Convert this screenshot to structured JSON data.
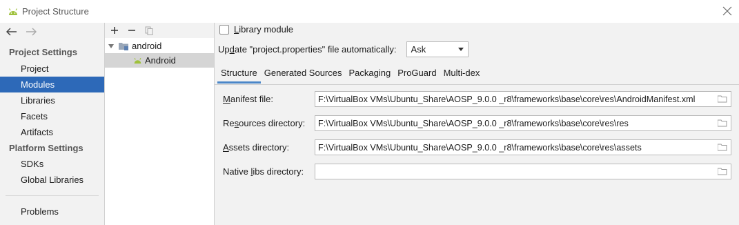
{
  "window": {
    "title": "Project Structure",
    "icon": "android-icon",
    "close_icon": "close-icon"
  },
  "sidebar": {
    "back_icon": "arrow-left-icon",
    "forward_icon": "arrow-right-icon",
    "project_settings_header": "Project Settings",
    "project_settings_items": [
      {
        "label": "Project",
        "selected": false
      },
      {
        "label": "Modules",
        "selected": true
      },
      {
        "label": "Libraries",
        "selected": false
      },
      {
        "label": "Facets",
        "selected": false
      },
      {
        "label": "Artifacts",
        "selected": false
      }
    ],
    "platform_settings_header": "Platform Settings",
    "platform_settings_items": [
      {
        "label": "SDKs"
      },
      {
        "label": "Global Libraries"
      }
    ],
    "problems_label": "Problems"
  },
  "module_tree": {
    "toolbar_icons": [
      "plus-icon",
      "minus-icon",
      "copy-icon"
    ],
    "nodes": [
      {
        "label": "android",
        "icon": "folder-module-icon",
        "expanded": true
      },
      {
        "label": "Android",
        "icon": "android-facet-icon",
        "selected": true
      }
    ]
  },
  "content": {
    "library_module": {
      "prefix": "",
      "mnemonic": "L",
      "rest": "ibrary module",
      "checked": false
    },
    "update_label": {
      "prefix": "Up",
      "mnemonic": "d",
      "rest": "ate \"project.properties\" file automatically:"
    },
    "update_select_value": "Ask",
    "tabs": [
      {
        "label": "Structure",
        "active": true
      },
      {
        "label": "Generated Sources",
        "active": false
      },
      {
        "label": "Packaging",
        "active": false
      },
      {
        "label": "ProGuard",
        "active": false
      },
      {
        "label": "Multi-dex",
        "active": false
      }
    ],
    "fields": [
      {
        "label_prefix": "",
        "mnemonic": "M",
        "label_rest": "anifest file:",
        "value": "F:\\VirtualBox VMs\\Ubuntu_Share\\AOSP_9.0.0 _r8\\frameworks\\base\\core\\res\\AndroidManifest.xml"
      },
      {
        "label_prefix": "Re",
        "mnemonic": "s",
        "label_rest": "ources directory:",
        "value": "F:\\VirtualBox VMs\\Ubuntu_Share\\AOSP_9.0.0 _r8\\frameworks\\base\\core\\res\\res"
      },
      {
        "label_prefix": "",
        "mnemonic": "A",
        "label_rest": "ssets directory:",
        "value": "F:\\VirtualBox VMs\\Ubuntu_Share\\AOSP_9.0.0 _r8\\frameworks\\base\\core\\res\\assets"
      },
      {
        "label_prefix": "Native ",
        "mnemonic": "l",
        "label_rest": "ibs directory:",
        "value": ""
      }
    ],
    "browse_icon": "folder-browse-icon"
  },
  "colors": {
    "selection": "#2d69b8",
    "tab_underline": "#4a86c8",
    "android_green": "#9fc13d"
  }
}
